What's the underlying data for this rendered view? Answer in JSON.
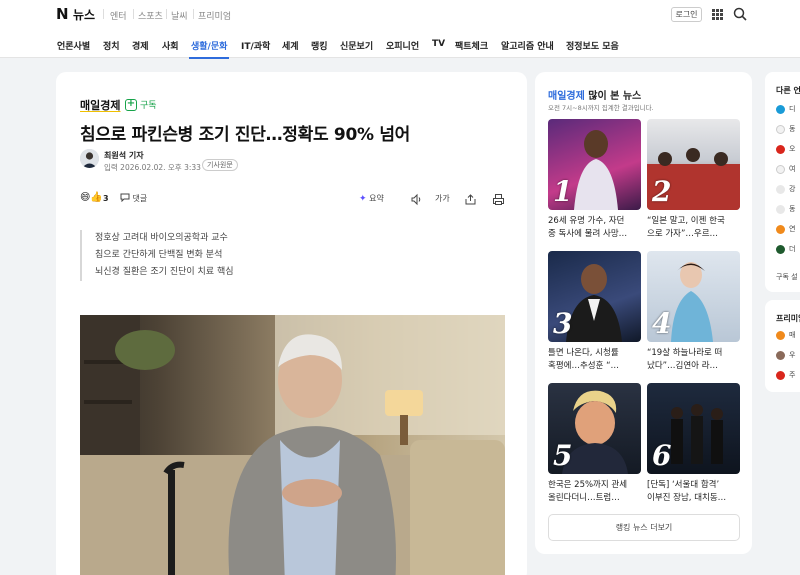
{
  "header": {
    "logo_n": "N",
    "logo_text": "뉴스",
    "services": [
      "엔터",
      "스포츠",
      "날씨",
      "프리미엄"
    ],
    "login_label": "로그인"
  },
  "nav": {
    "items": [
      "언론사별",
      "정치",
      "경제",
      "사회",
      "생활/문화",
      "IT/과학",
      "세계",
      "랭킹",
      "신문보기",
      "오피니언",
      "TV",
      "팩트체크",
      "알고리즘 안내",
      "정정보도 모음"
    ],
    "active": "생활/문화"
  },
  "article": {
    "press": "매일경제",
    "subscribe_label": "구독",
    "headline": "침으로 파킨슨병 조기 진단…정확도 90% 넘어",
    "reporter": "최원석 기자",
    "date": "입력 2026.02.02. 오후 3:33",
    "badge": "기사원문",
    "reaction_count": "3",
    "comment_label": "댓글",
    "summary_label": "요약",
    "fontsize_label": "가가",
    "summary_lines": [
      "정호상 고려대 바이오의공학과 교수",
      "침으로 간단하게 단백질 변화 분석",
      "뇌신경 질환은 조기 진단이 치료 핵심"
    ]
  },
  "ranking": {
    "press": "매일경제",
    "title_rest": "많이 본 뉴스",
    "subtitle": "오전 7시~8시까지 집계한 결과입니다.",
    "items": [
      {
        "rank": "1",
        "line1": "26세 유명 가수, 자던",
        "line2": "중 독사에 물려 사망…"
      },
      {
        "rank": "2",
        "line1": "“일본 말고, 이젠 한국",
        "line2": "으로 가자”…우르…"
      },
      {
        "rank": "3",
        "line1": "틀면 나온다, 시청률",
        "line2": "혹평에…추성훈 “…"
      },
      {
        "rank": "4",
        "line1": "“19살 하늘나라로 떠",
        "line2": "났다”…김연아 라…"
      },
      {
        "rank": "5",
        "line1": "한국은 25%까지 관세",
        "line2": "올린다더니…트럼…"
      },
      {
        "rank": "6",
        "line1": "[단독] ‘서울대 합격’",
        "line2": "이부진 장남, 대치동…"
      }
    ],
    "more_label": "랭킹 뉴스 더보기"
  },
  "side": {
    "title": "다른 언론",
    "rows": [
      "디",
      "동",
      "오",
      "여",
      "강",
      "동",
      "연",
      "더"
    ],
    "footer": "구독 설",
    "title2": "프리미엄",
    "rows2": [
      "매",
      "우",
      "주"
    ]
  },
  "colors": {
    "accent": "#2e6cdc",
    "subscribe": "#17a34a",
    "summary_spark": "#5b4fff"
  }
}
